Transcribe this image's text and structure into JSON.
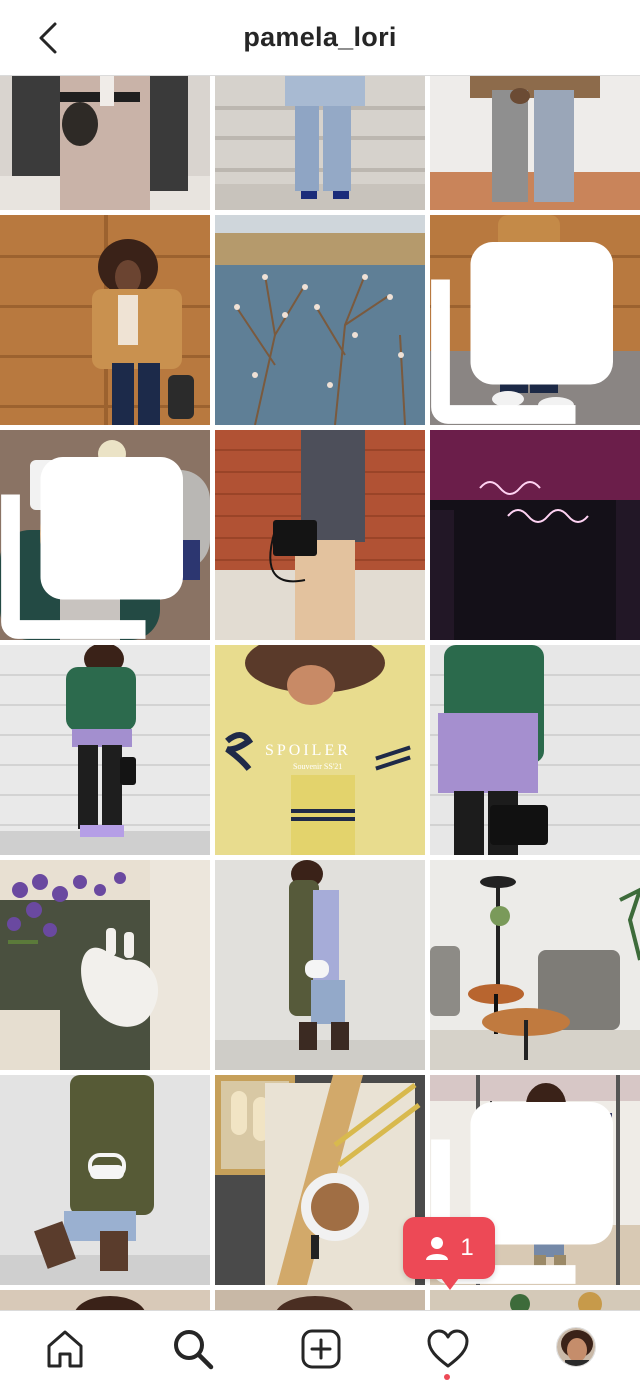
{
  "header": {
    "title": "pamela_lori",
    "back_icon": "chevron-left-icon"
  },
  "grid": {
    "posts": [
      {
        "desc": "houndstooth coat outfit",
        "multi": false
      },
      {
        "desc": "jeans on stone steps",
        "multi": false
      },
      {
        "desc": "wide jeans on tiles",
        "multi": false
      },
      {
        "desc": "shearling jacket by wood wall",
        "multi": false
      },
      {
        "desc": "blossoms by the sea",
        "multi": false
      },
      {
        "desc": "puffer jacket with sneakers",
        "multi": true
      },
      {
        "desc": "lunch box flatlay",
        "multi": true
      },
      {
        "desc": "check blazer with black bag",
        "multi": false
      },
      {
        "desc": "neon sign",
        "multi": false
      },
      {
        "desc": "green sweatshirt outfit",
        "multi": false
      },
      {
        "desc": "yellow varsity jacket",
        "multi": false
      },
      {
        "desc": "green sweatshirt with bag",
        "multi": false
      },
      {
        "desc": "lavender and heart vase",
        "multi": false
      },
      {
        "desc": "olive coat with white bag",
        "multi": false
      },
      {
        "desc": "lounge chairs and table",
        "multi": false
      },
      {
        "desc": "olive coat with boots",
        "multi": false
      },
      {
        "desc": "coffee and pastries",
        "multi": false
      },
      {
        "desc": "mirror selfie in shop",
        "multi": true
      }
    ],
    "spoiler_text": "SPOILER",
    "spoiler_sub": "Souvenir SS'21"
  },
  "notification": {
    "count": "1",
    "icon": "person-icon",
    "color": "#ed4956"
  },
  "tabbar": {
    "items": [
      "home-icon",
      "search-icon",
      "new-post-icon",
      "activity-heart-icon",
      "profile-avatar"
    ],
    "active_dot_color": "#ed4956"
  }
}
